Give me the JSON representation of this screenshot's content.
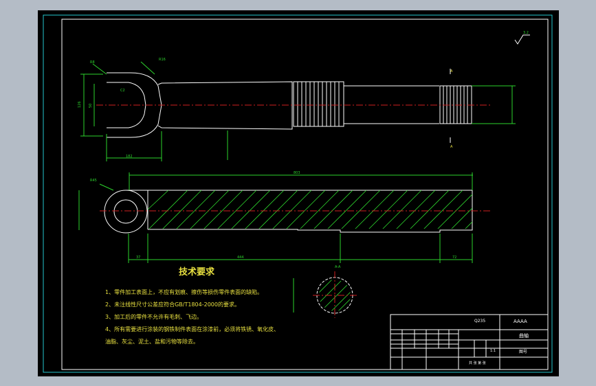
{
  "drawing": {
    "tech_title": "技术要求",
    "requirements": [
      "1、零件加工表面上，不应有划痕、擦伤等损伤零件表面的缺陷。",
      "2、未注线性尺寸公差应符合GB/T1804-2000的要求。",
      "3、加工后的零件不允许有毛刺、飞边。",
      "4、所有需要进行涂装的钢铁制件表面在涂漆前，必须将铁锈、氧化皮、",
      "油脂、灰尘、泥土、盐和污物等除去。"
    ],
    "roughness": "3.2",
    "dims": {
      "r8": "R8",
      "r16": "R16",
      "len182": "182",
      "d126": "126",
      "d50": "50",
      "c2": "C2",
      "total_len": "803",
      "len37": "37",
      "len444": "444",
      "len72": "72",
      "r45": "R45",
      "section": "A-A"
    },
    "section_label": "A",
    "title_block": {
      "material": "Q235",
      "code": "AAAA",
      "part_name": "曲轴",
      "drawing_no": "图号",
      "scale": "1:1",
      "sheets": "共 张 第 张"
    }
  },
  "colors": {
    "background": "#000000",
    "frame": "#ffffff",
    "dimension": "#2dd42d",
    "text": "#e8e040",
    "centerline": "#d02020",
    "border": "#24c8d0"
  }
}
